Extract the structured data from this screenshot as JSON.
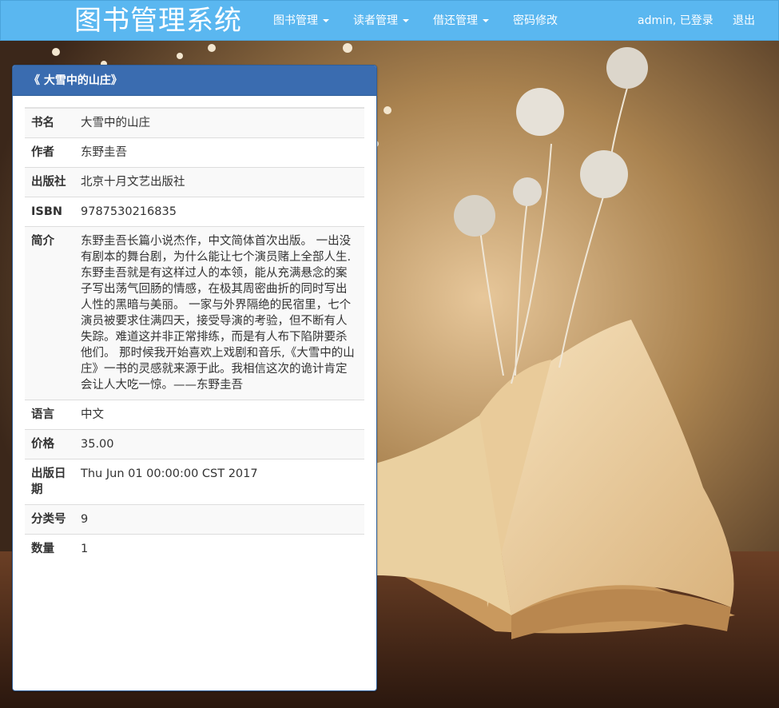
{
  "navbar": {
    "brand": "图书管理系统",
    "menus": [
      {
        "label": "图书管理",
        "dropdown": true
      },
      {
        "label": "读者管理",
        "dropdown": true
      },
      {
        "label": "借还管理",
        "dropdown": true
      },
      {
        "label": "密码修改",
        "dropdown": false
      }
    ],
    "user_status": "admin, 已登录",
    "logout": "退出",
    "bg_color": "#5ab7f0"
  },
  "panel": {
    "title": "《 大雪中的山庄》",
    "header_color": "#3a6cb0",
    "rows": [
      {
        "key": "书名",
        "value": "大雪中的山庄"
      },
      {
        "key": "作者",
        "value": "东野圭吾"
      },
      {
        "key": "出版社",
        "value": "北京十月文艺出版社"
      },
      {
        "key": "ISBN",
        "value": "9787530216835"
      },
      {
        "key": "简介",
        "value": "东野圭吾长篇小说杰作，中文简体首次出版。 一出没有剧本的舞台剧，为什么能让七个演员赌上全部人生.东野圭吾就是有这样过人的本领，能从充满悬念的案子写出荡气回肠的情感，在极其周密曲折的同时写出人性的黑暗与美丽。 一家与外界隔绝的民宿里，七个演员被要求住满四天，接受导演的考验，但不断有人失踪。难道这并非正常排练，而是有人布下陷阱要杀他们。 那时候我开始喜欢上戏剧和音乐,《大雪中的山庄》一书的灵感就来源于此。我相信这次的诡计肯定会让人大吃一惊。——东野圭吾"
      },
      {
        "key": "语言",
        "value": "中文"
      },
      {
        "key": "价格",
        "value": "35.00"
      },
      {
        "key": "出版日期",
        "value": "Thu Jun 01 00:00:00 CST 2017"
      },
      {
        "key": "分类号",
        "value": "9"
      },
      {
        "key": "数量",
        "value": "1"
      }
    ]
  }
}
